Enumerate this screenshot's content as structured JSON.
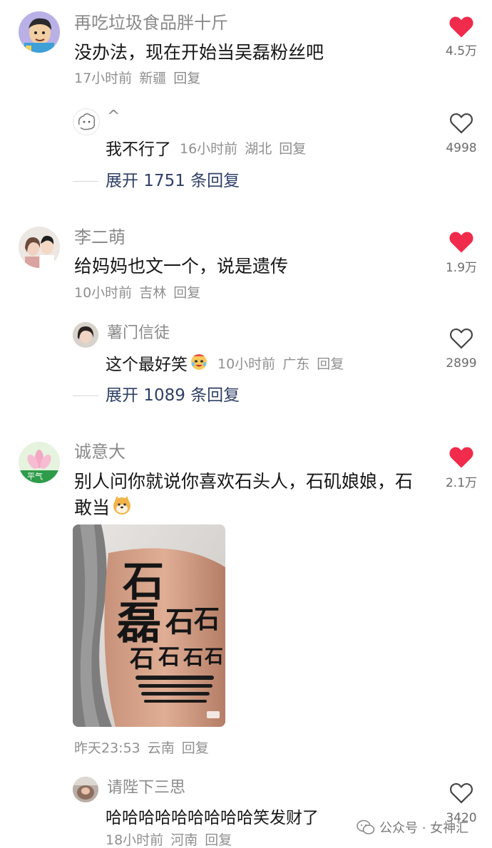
{
  "comments": [
    {
      "username": "再吃垃圾食品胖十斤",
      "text": "没办法，现在开始当吴磊粉丝吧",
      "time": "17小时前",
      "location": "新疆",
      "reply_label": "回复",
      "likes": "4.5万",
      "liked": true,
      "reply": {
        "username": "^",
        "text": "我不行了",
        "time": "16小时前",
        "location": "湖北",
        "reply_label": "回复",
        "likes": "4998"
      },
      "expand_label": "展开 1751 条回复"
    },
    {
      "username": "李二萌",
      "text": "给妈妈也文一个，说是遗传",
      "time": "10小时前",
      "location": "吉林",
      "reply_label": "回复",
      "likes": "1.9万",
      "liked": true,
      "reply": {
        "username": "薯门信徒",
        "text": "这个最好笑",
        "time": "10小时前",
        "location": "广东",
        "reply_label": "回复",
        "likes": "2899"
      },
      "expand_label": "展开 1089 条回复"
    },
    {
      "username": "诚意大",
      "avatar_text": "平气",
      "text_line1": "别人问你就说你喜欢石头人，石矶娘娘，石",
      "text_line2": "敢当",
      "time": "昨天23:53",
      "location": "云南",
      "reply_label": "回复",
      "likes": "2.1万",
      "liked": true,
      "image_tattoo_chars": [
        "石",
        "磊",
        "石",
        "石",
        "石",
        "石",
        "石",
        "石"
      ],
      "reply": {
        "username": "请陛下三思",
        "text": "哈哈哈哈哈哈哈哈哈笑发财了",
        "time": "18小时前",
        "location": "河南",
        "reply_label": "回复",
        "likes": "3420"
      }
    }
  ],
  "watermark": "公众号 · 女神汇",
  "colors": {
    "like_red": "#f02b4b",
    "expand_blue": "#2f3f66"
  },
  "icons": {
    "liked": "heart-filled-icon",
    "unliked": "heart-outline-icon",
    "wechat": "wechat-icon"
  }
}
